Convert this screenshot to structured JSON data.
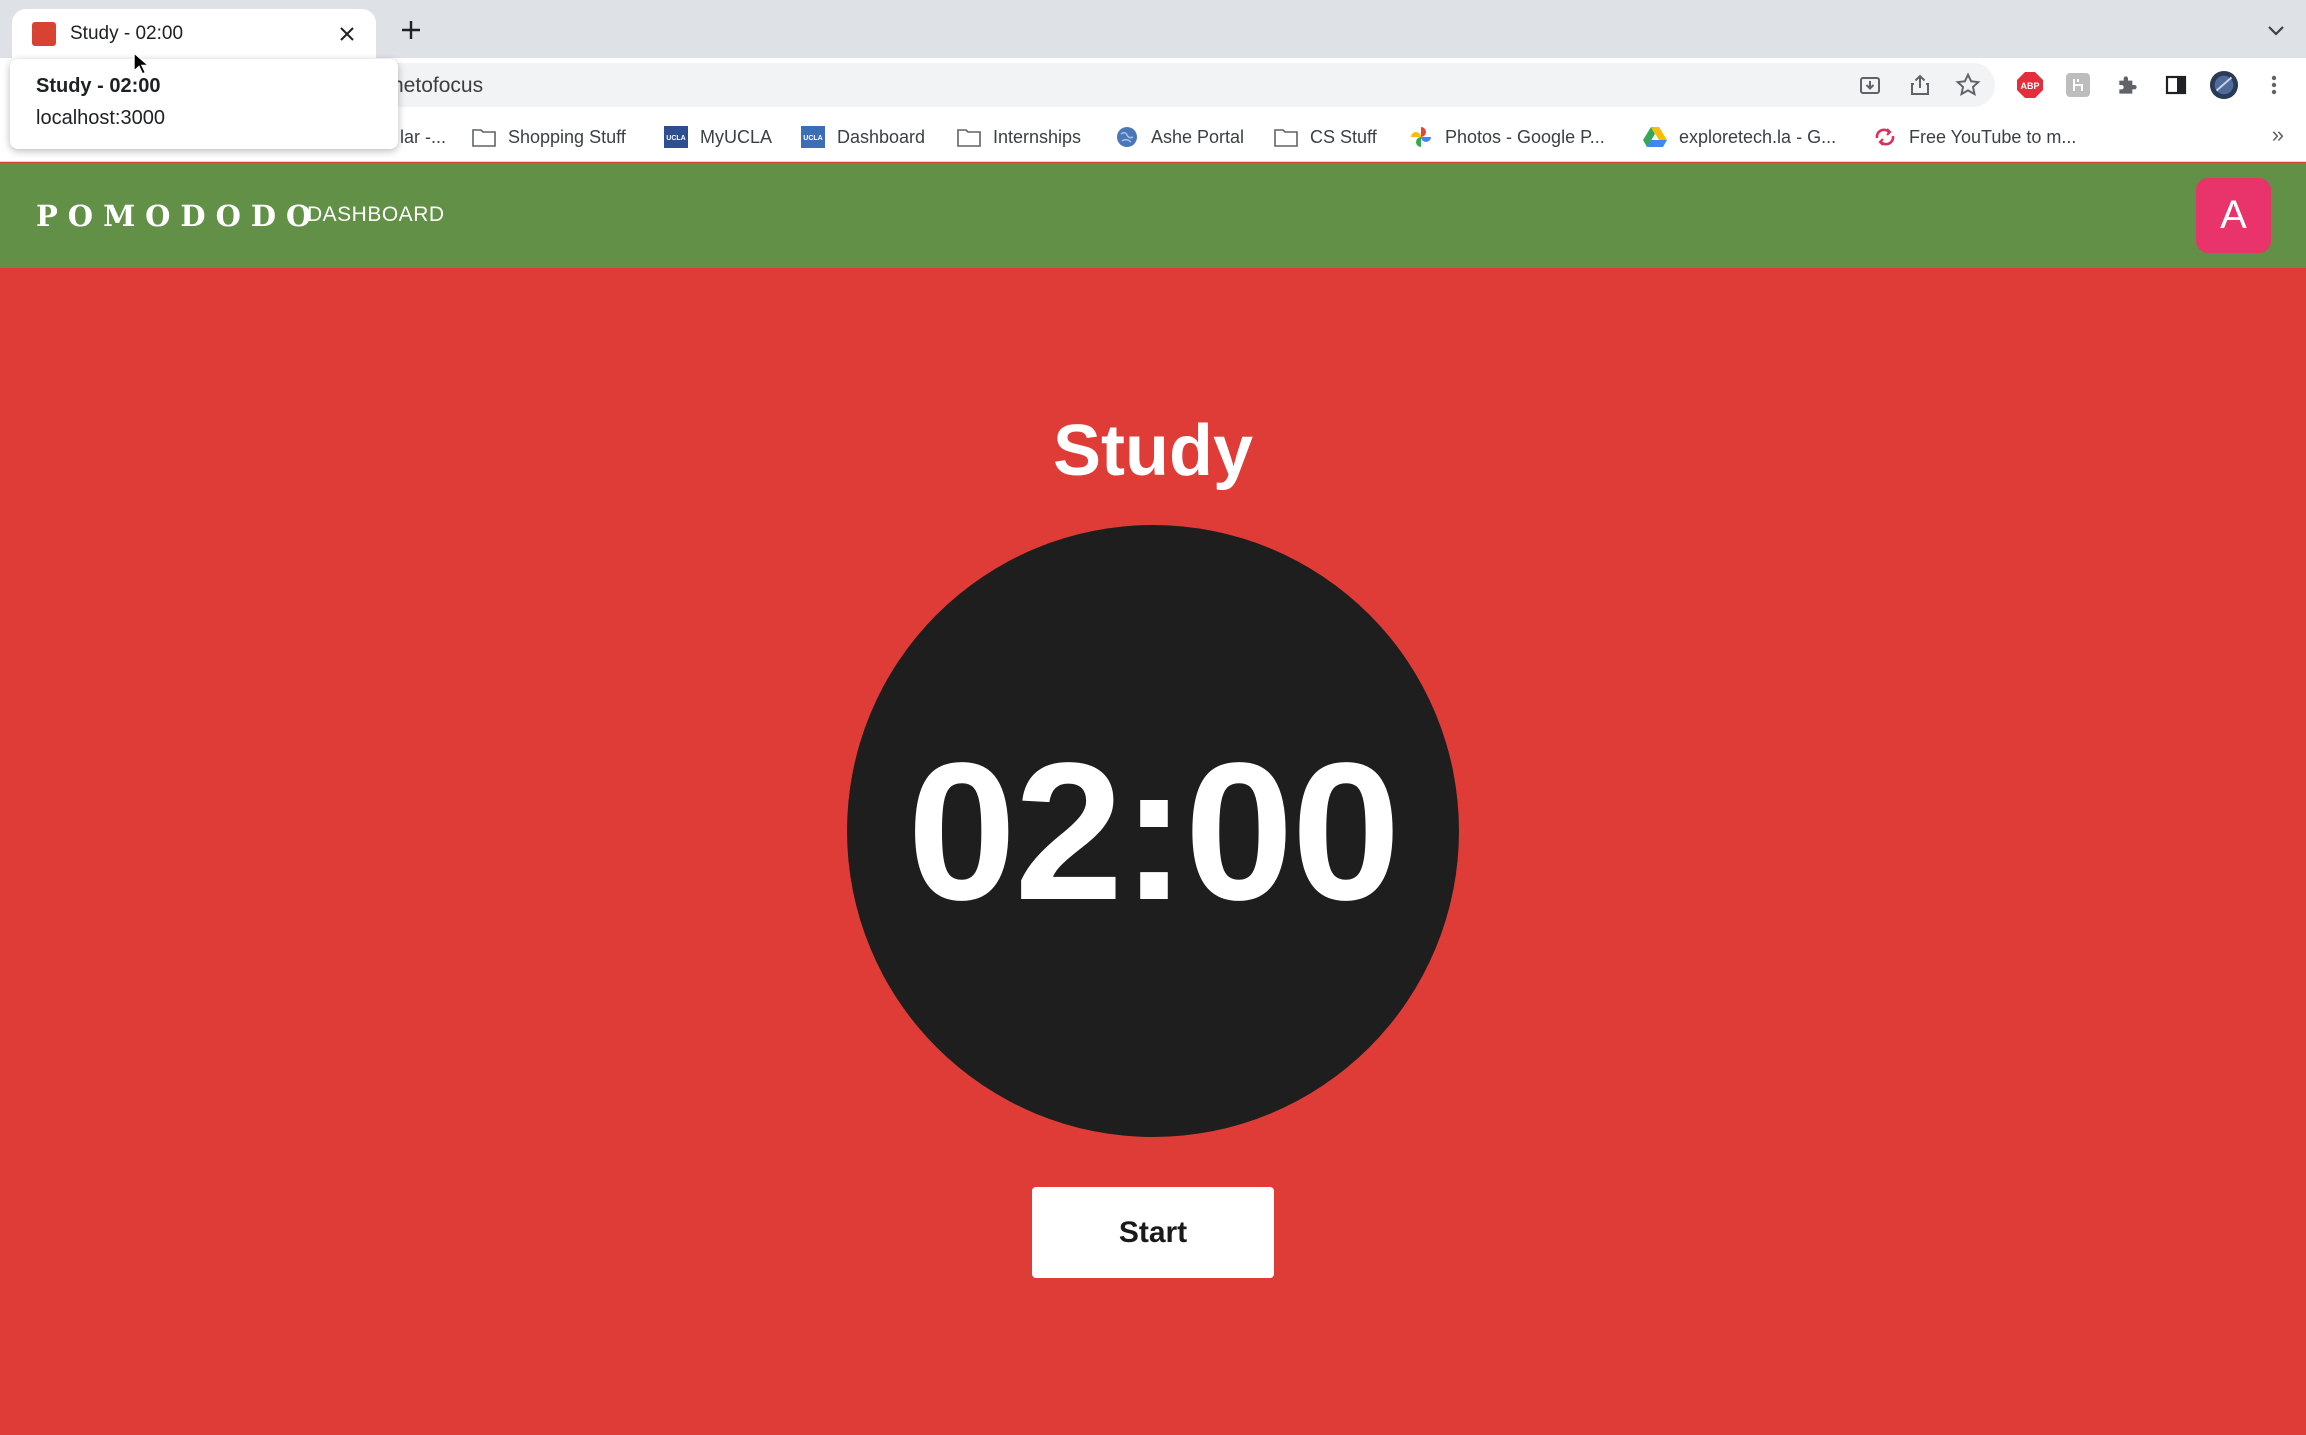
{
  "browser": {
    "tab": {
      "title": "Study - 02:00",
      "favicon_color": "#d84232"
    },
    "tooltip": {
      "title": "Study - 02:00",
      "url": "localhost:3000"
    },
    "address": {
      "visible_text": "netofocus"
    },
    "bookmarks": [
      {
        "label": "lar -...",
        "icon": "calendar-icon"
      },
      {
        "label": "Shopping Stuff",
        "icon": "folder-icon"
      },
      {
        "label": "MyUCLA",
        "icon": "ucla-icon"
      },
      {
        "label": "Dashboard",
        "icon": "ucla-icon"
      },
      {
        "label": "Internships",
        "icon": "folder-icon"
      },
      {
        "label": "Ashe Portal",
        "icon": "globe-icon"
      },
      {
        "label": "CS Stuff",
        "icon": "folder-icon"
      },
      {
        "label": "Photos - Google P...",
        "icon": "google-photos-icon"
      },
      {
        "label": "exploretech.la - G...",
        "icon": "google-drive-icon"
      },
      {
        "label": "Free YouTube to m...",
        "icon": "converter-icon"
      }
    ],
    "more_bookmarks": "»"
  },
  "app": {
    "logo": "POMODODO",
    "nav": {
      "dashboard": "DASHBOARD"
    },
    "avatar_initial": "A",
    "mode_title": "Study",
    "timer": "02:00",
    "start_label": "Start",
    "colors": {
      "header": "#629046",
      "background": "#e03c37",
      "timer_circle": "#1e1e1e",
      "avatar": "#e8346a"
    }
  }
}
